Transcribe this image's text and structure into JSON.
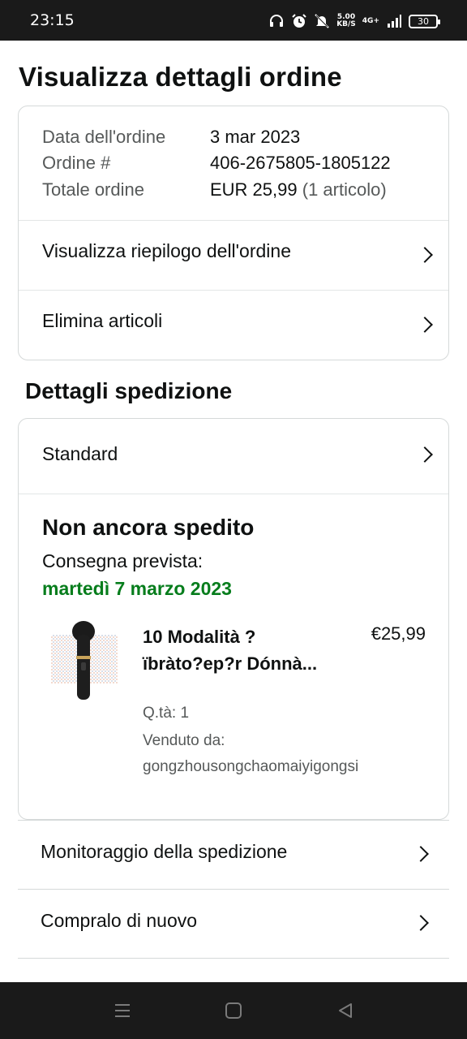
{
  "status_bar": {
    "time": "23:15",
    "net_speed_top": "5.00",
    "net_speed_bottom": "KB/S",
    "signal_label": "4G+",
    "battery": "30"
  },
  "page_title": "Visualizza dettagli ordine",
  "order": {
    "date_label": "Data dell'ordine",
    "date_value": "3 mar 2023",
    "number_label": "Ordine #",
    "number_value": "406-2675805-1805122",
    "total_label": "Totale ordine",
    "total_value": "EUR 25,99",
    "total_items": "(1 articolo)",
    "summary_link": "Visualizza riepilogo dell'ordine",
    "delete_link": "Elimina articoli"
  },
  "shipping": {
    "section_title": "Dettagli spedizione",
    "method": "Standard",
    "status": "Non ancora spedito",
    "delivery_label": "Consegna prevista:",
    "delivery_date": "martedì 7 marzo 2023",
    "delivery_color": "#067d1c",
    "product": {
      "name": "10 Modalità ? ïbràto?ep?r Dónnà...",
      "price": "€25,99",
      "qty": "Q.tà: 1",
      "seller_label": "Venduto da:",
      "seller_name": "gongzhousongchaomaiyigongsi"
    }
  },
  "actions": {
    "tracking": "Monitoraggio della spedizione",
    "buy_again": "Compralo di nuovo"
  },
  "nav": {
    "menu": "menu-icon",
    "home": "home-icon",
    "back": "back-icon"
  }
}
